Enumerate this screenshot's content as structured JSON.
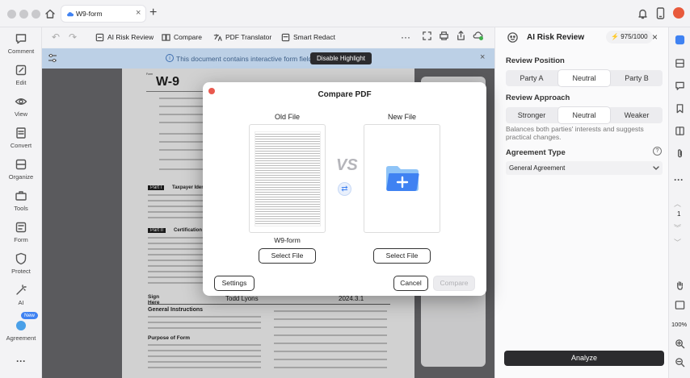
{
  "tab": {
    "title": "W9-form"
  },
  "left_sidebar": {
    "items": [
      {
        "label": "Comment"
      },
      {
        "label": "Edit"
      },
      {
        "label": "View"
      },
      {
        "label": "Convert"
      },
      {
        "label": "Organize"
      },
      {
        "label": "Tools"
      },
      {
        "label": "Form"
      },
      {
        "label": "Protect"
      },
      {
        "label": "AI"
      },
      {
        "label": "Agreement",
        "badge": "New"
      }
    ]
  },
  "toolbar": {
    "ai_risk_review": "AI Risk Review",
    "compare": "Compare",
    "pdf_translator": "PDF Translator",
    "smart_redact": "Smart Redact"
  },
  "notice": {
    "text": "This document contains interactive form fields.",
    "button": "Disable Highlight"
  },
  "document": {
    "form_code": "W-9",
    "sign_label": "Sign Here",
    "signature": "Todd Lyons",
    "date": "2024.3.1",
    "part1": "Taxpayer Identification",
    "part2": "Certification",
    "heading_general": "General Instructions",
    "heading_purpose": "Purpose of Form"
  },
  "ai_panel": {
    "title": "AI Risk Review",
    "credits": "975/1000",
    "review_position": {
      "label": "Review Position",
      "options": [
        "Party A",
        "Neutral",
        "Party B"
      ],
      "selected": "Neutral"
    },
    "review_approach": {
      "label": "Review Approach",
      "options": [
        "Stronger",
        "Neutral",
        "Weaker"
      ],
      "selected": "Neutral",
      "description": "Balances both parties' interests and suggests practical changes."
    },
    "agreement_type": {
      "label": "Agreement Type",
      "value": "General Agreement"
    },
    "analyze_button": "Analyze"
  },
  "right_strip": {
    "page_number": "1",
    "zoom": "100%"
  },
  "dialog": {
    "title": "Compare PDF",
    "old_file_label": "Old File",
    "new_file_label": "New File",
    "old_file_name": "W9-form",
    "vs": "VS",
    "select_file": "Select File",
    "settings": "Settings",
    "cancel": "Cancel",
    "compare": "Compare"
  },
  "colors": {
    "accent_blue": "#3f82f2",
    "analyze_bg": "#2b2b2e",
    "notice_bg": "#bcd0e6"
  }
}
